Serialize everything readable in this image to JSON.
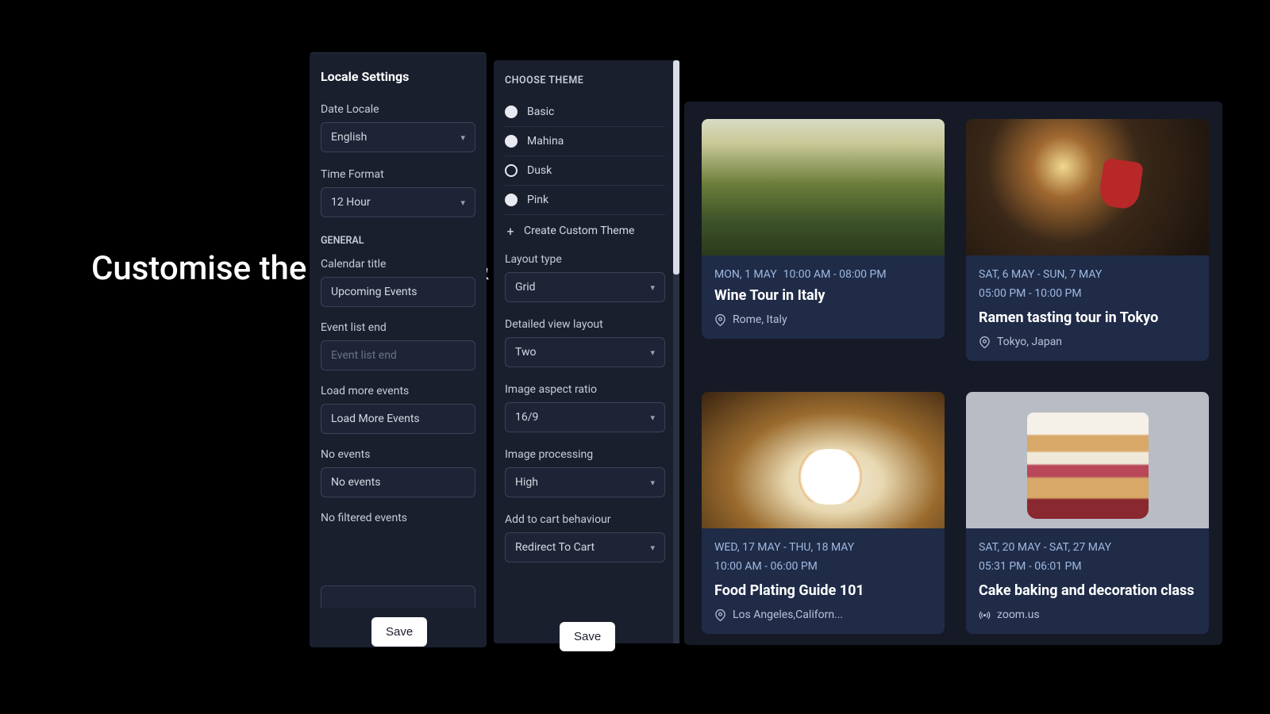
{
  "headline": "Customise the apps look & language",
  "locale": {
    "title": "Locale Settings",
    "date_locale_label": "Date Locale",
    "date_locale_value": "English",
    "time_format_label": "Time Format",
    "time_format_value": "12 Hour",
    "general_label": "GENERAL",
    "calendar_title_label": "Calendar title",
    "calendar_title_value": "Upcoming Events",
    "event_list_end_label": "Event list end",
    "event_list_end_placeholder": "Event list end",
    "load_more_label": "Load more events",
    "load_more_value": "Load More Events",
    "no_events_label": "No events",
    "no_events_value": "No events",
    "no_filtered_label": "No filtered events",
    "save": "Save"
  },
  "theme": {
    "choose_label": "CHOOSE THEME",
    "options": {
      "basic": "Basic",
      "mahina": "Mahina",
      "dusk": "Dusk",
      "pink": "Pink"
    },
    "create_custom": "Create Custom Theme",
    "layout_type_label": "Layout type",
    "layout_type_value": "Grid",
    "detailed_view_label": "Detailed view layout",
    "detailed_view_value": "Two",
    "aspect_label": "Image aspect ratio",
    "aspect_value": "16/9",
    "processing_label": "Image processing",
    "processing_value": "High",
    "cart_label": "Add to cart behaviour",
    "cart_value": "Redirect To Cart",
    "save": "Save"
  },
  "events": {
    "e1": {
      "date": "MON, 1 MAY",
      "time": "10:00 AM - 08:00 PM",
      "title": "Wine Tour in Italy",
      "location": "Rome, Italy"
    },
    "e2": {
      "date": "SAT, 6 MAY - SUN, 7 MAY",
      "time": "05:00 PM - 10:00 PM",
      "title": "Ramen tasting tour in Tokyo",
      "location": "Tokyo, Japan"
    },
    "e3": {
      "date": "WED, 17 MAY - THU, 18 MAY",
      "time": "10:00 AM - 06:00 PM",
      "title": "Food Plating Guide 101",
      "location": "Los Angeles,Californ..."
    },
    "e4": {
      "date": "SAT, 20 MAY - SAT, 27 MAY",
      "time": "05:31 PM - 06:01 PM",
      "title": "Cake baking and decoration class",
      "location": "zoom.us"
    }
  }
}
